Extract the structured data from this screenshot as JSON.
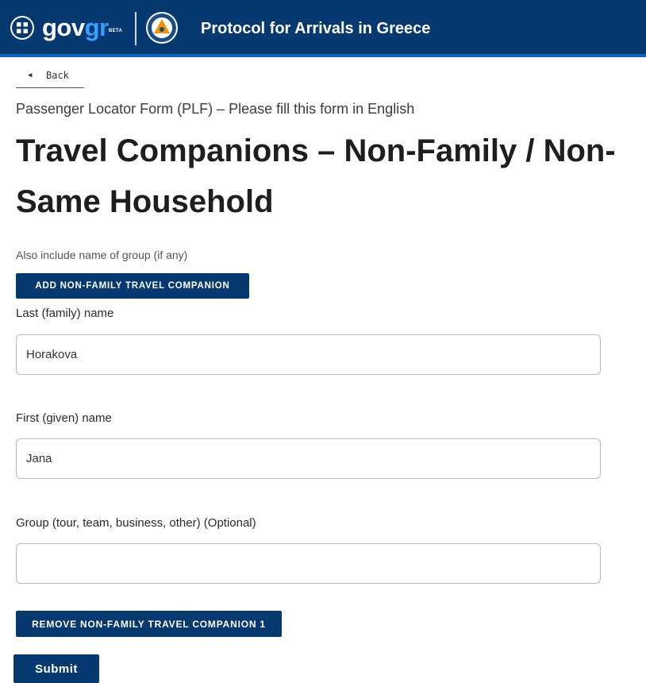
{
  "header": {
    "brand_gov": "gov",
    "brand_gr": "gr",
    "beta": "BETA",
    "title": "Protocol for Arrivals in Greece"
  },
  "nav": {
    "back_label": "Back"
  },
  "page": {
    "subtitle": "Passenger Locator Form (PLF) – Please fill this form in English",
    "title_line1": "Travel Companions – Non-Family / Non-",
    "title_line2": "Same Household",
    "hint": "Also include name of group (if any)"
  },
  "buttons": {
    "add": "ADD NON-FAMILY TRAVEL COMPANION",
    "remove": "REMOVE NON-FAMILY TRAVEL COMPANION 1",
    "submit": "Submit"
  },
  "form": {
    "last_name": {
      "label": "Last (family) name",
      "value": "Horakova"
    },
    "first_name": {
      "label": "First (given) name",
      "value": "Jana"
    },
    "group": {
      "label": "Group (tour, team, business, other) (Optional)",
      "value": ""
    }
  },
  "colors": {
    "header_bg": "#063970",
    "header_accent": "#0b66c2",
    "brand_gr": "#3aa0ff",
    "button_bg": "#063970"
  }
}
